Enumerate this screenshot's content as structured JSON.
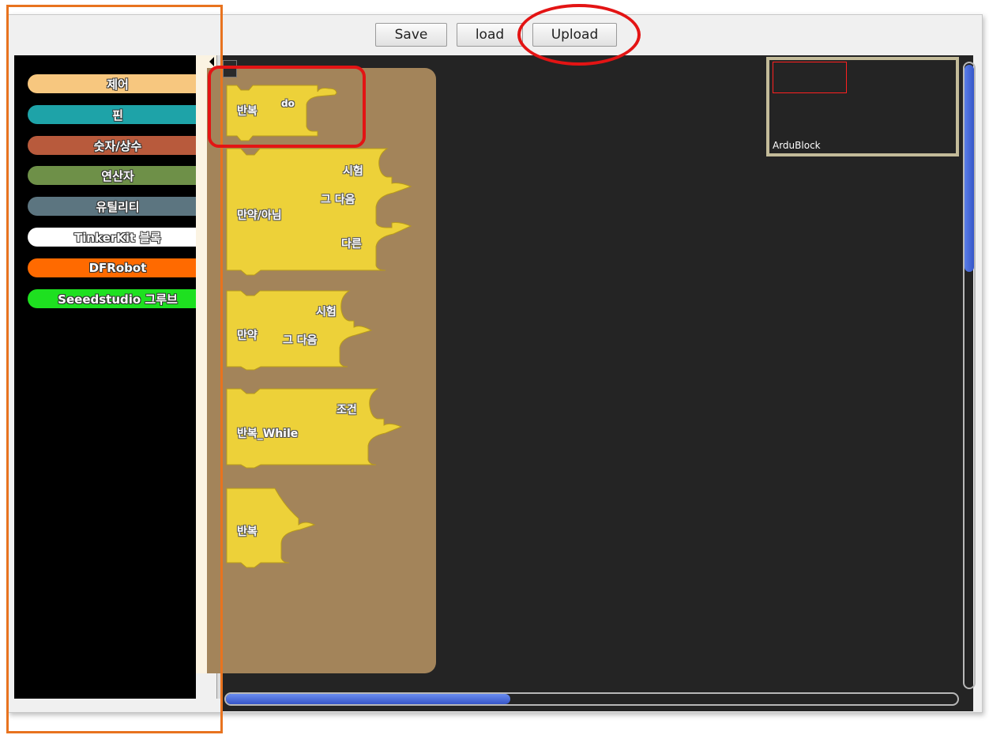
{
  "toolbar": {
    "save_label": "Save",
    "load_label": "load",
    "upload_label": "Upload"
  },
  "palette": {
    "categories": [
      {
        "label": "제어",
        "color": "#f7c77f"
      },
      {
        "label": "핀",
        "color": "#1ea3a8"
      },
      {
        "label": "숫자/상수",
        "color": "#b85a3c"
      },
      {
        "label": "연산자",
        "color": "#6e9048"
      },
      {
        "label": "유틸리티",
        "color": "#5c7580"
      },
      {
        "label": "TinkerKit 블록",
        "color": "#ffffff"
      },
      {
        "label": "DFRobot",
        "color": "#ff6a00"
      },
      {
        "label": "Seeedstudio 그루브",
        "color": "#1ee020"
      }
    ]
  },
  "blocks": {
    "repeat_do": {
      "label": "반복",
      "suffix": "do"
    },
    "if_else": {
      "label": "만약/아님",
      "socket_test": "시험",
      "socket_then": "그 다음",
      "socket_else": "다른"
    },
    "if": {
      "label": "만약",
      "socket_test": "시험",
      "socket_then": "그 다음"
    },
    "while": {
      "label": "반복_While",
      "socket_cond": "조건"
    },
    "repeat": {
      "label": "반복"
    }
  },
  "minimap": {
    "label": "ArduBlock"
  },
  "colors": {
    "block_yellow": "#edd139",
    "drawer_brown": "#a3845a",
    "canvas_bg": "#242424",
    "annotation_orange": "#e8731f",
    "annotation_red": "#e31414"
  }
}
